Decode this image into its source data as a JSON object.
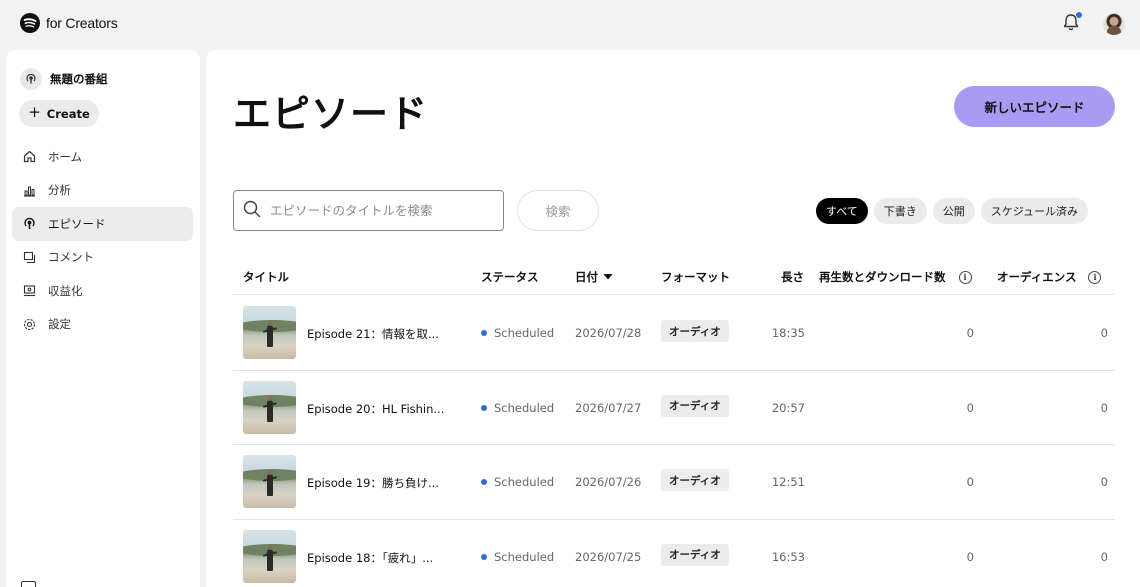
{
  "app": {
    "brand": "for Creators",
    "colors": {
      "accent": "#a99af4",
      "status_dot": "#2f6de1",
      "notification_dot": "#2f6de1"
    }
  },
  "sidebar": {
    "show_name": "無題の番組",
    "create_label": "Create",
    "items": [
      {
        "label": "ホーム",
        "icon": "home-icon"
      },
      {
        "label": "分析",
        "icon": "analytics-icon"
      },
      {
        "label": "エピソード",
        "icon": "podcast-icon",
        "active": true
      },
      {
        "label": "コメント",
        "icon": "comment-icon"
      },
      {
        "label": "収益化",
        "icon": "monetize-icon"
      },
      {
        "label": "設定",
        "icon": "gear-icon"
      }
    ]
  },
  "main": {
    "title": "エピソード",
    "new_button": "新しいエピソード",
    "search": {
      "placeholder": "エピソードのタイトルを検索",
      "button": "検索"
    },
    "filters": [
      {
        "label": "すべて",
        "active": true
      },
      {
        "label": "下書き",
        "active": false
      },
      {
        "label": "公開",
        "active": false
      },
      {
        "label": "スケジュール済み",
        "active": false
      }
    ],
    "columns": {
      "title": "タイトル",
      "status": "ステータス",
      "date": "日付",
      "format": "フォーマット",
      "length": "長さ",
      "plays": "再生数とダウンロード数",
      "audience": "オーディエンス"
    },
    "episodes": [
      {
        "title": "Episode 21：情報を取...",
        "status": "Scheduled",
        "date": "2026/07/28",
        "format": "オーディオ",
        "length": "18:35",
        "plays": "0",
        "audience": "0"
      },
      {
        "title": "Episode 20：HL Fishin...",
        "status": "Scheduled",
        "date": "2026/07/27",
        "format": "オーディオ",
        "length": "20:57",
        "plays": "0",
        "audience": "0"
      },
      {
        "title": "Episode 19：勝ち負け...",
        "status": "Scheduled",
        "date": "2026/07/26",
        "format": "オーディオ",
        "length": "12:51",
        "plays": "0",
        "audience": "0"
      },
      {
        "title": "Episode 18：「疲れ」...",
        "status": "Scheduled",
        "date": "2026/07/25",
        "format": "オーディオ",
        "length": "16:53",
        "plays": "0",
        "audience": "0"
      }
    ]
  }
}
